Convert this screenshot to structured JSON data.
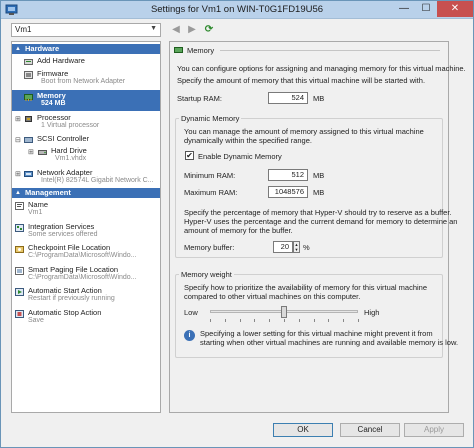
{
  "window": {
    "title": "Settings for Vm1 on WIN-T0G1FD19U56",
    "minimize": "—",
    "maximize": "☐",
    "close": "✕"
  },
  "vm_selector": {
    "value": "Vm1",
    "arrow": "▼"
  },
  "toolbar": {
    "back": "◀",
    "forward": "▶",
    "refresh": "⟳"
  },
  "tree": {
    "hardware_header": "Hardware",
    "management_header": "Management",
    "hardware_items": [
      {
        "label": "Add Hardware",
        "sub": "",
        "icon": "add-hardware-icon"
      },
      {
        "label": "Firmware",
        "sub": "Boot from Network Adapter",
        "icon": "firmware-icon"
      },
      {
        "label": "Memory",
        "sub": "524 MB",
        "icon": "memory-icon"
      },
      {
        "label": "Processor",
        "sub": "1 Virtual processor",
        "icon": "processor-icon"
      },
      {
        "label": "SCSI Controller",
        "sub": "",
        "icon": "scsi-controller-icon"
      },
      {
        "label": "Hard Drive",
        "sub": "Vm1.vhdx",
        "icon": "hard-drive-icon"
      },
      {
        "label": "Network Adapter",
        "sub": "Intel(R) 82574L Gigabit Network C...",
        "icon": "network-adapter-icon"
      }
    ],
    "management_items": [
      {
        "label": "Name",
        "sub": "Vm1",
        "icon": "name-icon"
      },
      {
        "label": "Integration Services",
        "sub": "Some services offered",
        "icon": "integration-services-icon"
      },
      {
        "label": "Checkpoint File Location",
        "sub": "C:\\ProgramData\\Microsoft\\Windo...",
        "icon": "checkpoint-icon"
      },
      {
        "label": "Smart Paging File Location",
        "sub": "C:\\ProgramData\\Microsoft\\Windo...",
        "icon": "smart-paging-icon"
      },
      {
        "label": "Automatic Start Action",
        "sub": "Restart if previously running",
        "icon": "auto-start-icon"
      },
      {
        "label": "Automatic Stop Action",
        "sub": "Save",
        "icon": "auto-stop-icon"
      }
    ]
  },
  "memory_panel": {
    "heading": "Memory",
    "intro": "You can configure options for assigning and managing memory for this virtual machine.",
    "specify": "Specify the amount of memory that this virtual machine will be started with.",
    "startup_ram_label": "Startup RAM:",
    "startup_ram_value": "524",
    "unit_mb": "MB",
    "dynamic_group_title": "Dynamic Memory",
    "dynamic_desc_1": "You can manage the amount of memory assigned to this virtual machine",
    "dynamic_desc_2": "dynamically within the specified range.",
    "enable_dynamic_label": "Enable Dynamic Memory",
    "enable_dynamic_checked": "✔",
    "min_ram_label": "Minimum RAM:",
    "min_ram_value": "512",
    "max_ram_label": "Maximum RAM:",
    "max_ram_value": "1048576",
    "buffer_desc_1": "Specify the percentage of memory that Hyper-V should try to reserve as a buffer.",
    "buffer_desc_2": "Hyper-V uses the percentage and the current demand for memory to determine an",
    "buffer_desc_3": "amount of memory for the buffer.",
    "buffer_label": "Memory buffer:",
    "buffer_value": "20",
    "percent": "%",
    "weight_group_title": "Memory weight",
    "weight_desc_1": "Specify how to prioritize the availability of memory for this virtual machine",
    "weight_desc_2": "compared to other virtual machines on this computer.",
    "low_label": "Low",
    "high_label": "High",
    "weight_level": 0.5,
    "note_1": "Specifying a lower setting for this virtual machine might prevent it from",
    "note_2": "starting when other virtual machines are running and available memory is low.",
    "info_glyph": "i"
  },
  "buttons": {
    "ok": "OK",
    "cancel": "Cancel",
    "apply": "Apply"
  },
  "colors": {
    "selection": "#3b70b6",
    "titlebar": "#b9d1ea",
    "close": "#c75050"
  }
}
